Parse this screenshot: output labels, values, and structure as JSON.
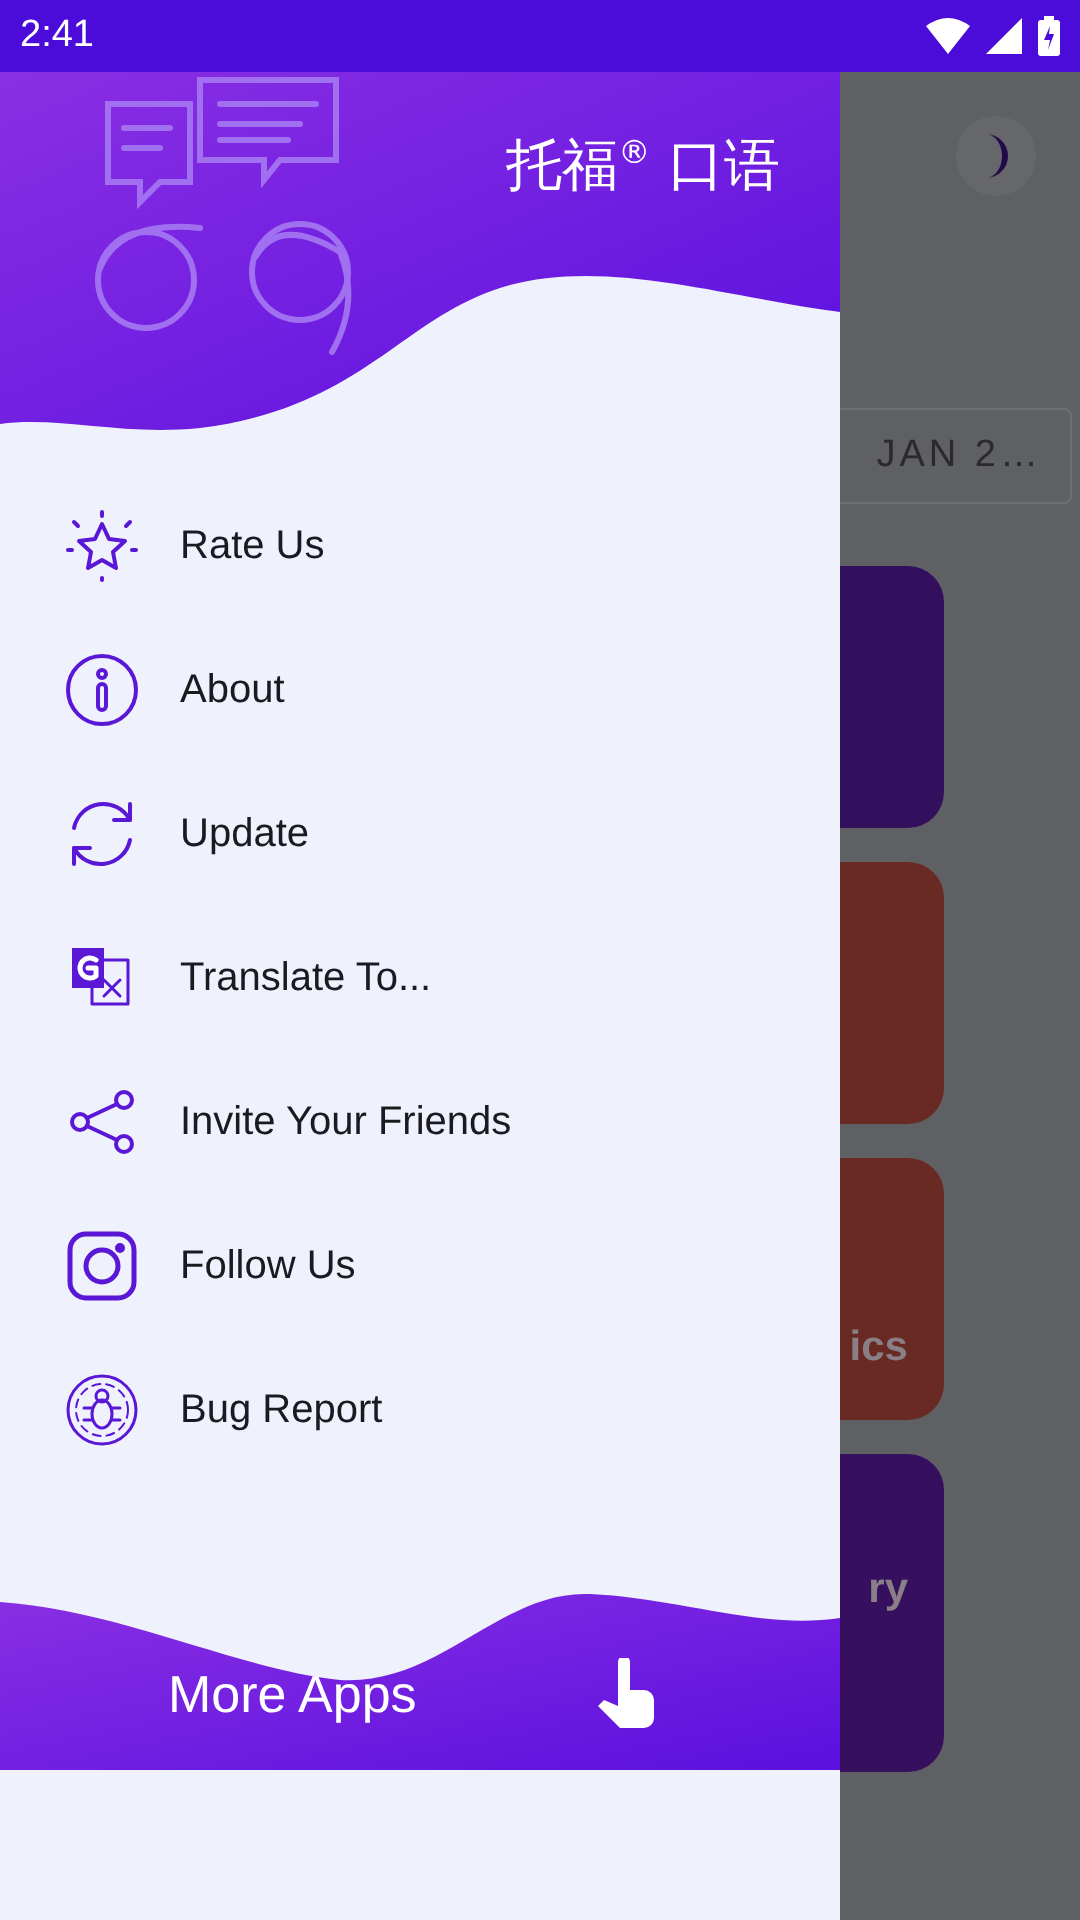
{
  "status_bar": {
    "time": "2:41"
  },
  "background": {
    "date_chip": "JAN 2…",
    "cards": [
      {
        "color": "#33105e"
      },
      {
        "color": "#6a2a24"
      },
      {
        "color": "#6a2a24",
        "label": "ics"
      },
      {
        "color": "#36105f",
        "label": "ry"
      }
    ]
  },
  "drawer": {
    "title": "托福$^{®}$ 口语",
    "menu": [
      {
        "kind": "star",
        "label": "Rate Us"
      },
      {
        "kind": "info",
        "label": "About"
      },
      {
        "kind": "refresh",
        "label": "Update"
      },
      {
        "kind": "translate",
        "label": "Translate To..."
      },
      {
        "kind": "share",
        "label": "Invite Your Friends"
      },
      {
        "kind": "camera",
        "label": "Follow Us"
      },
      {
        "kind": "bug",
        "label": "Bug Report"
      }
    ],
    "more_apps": "More Apps"
  }
}
